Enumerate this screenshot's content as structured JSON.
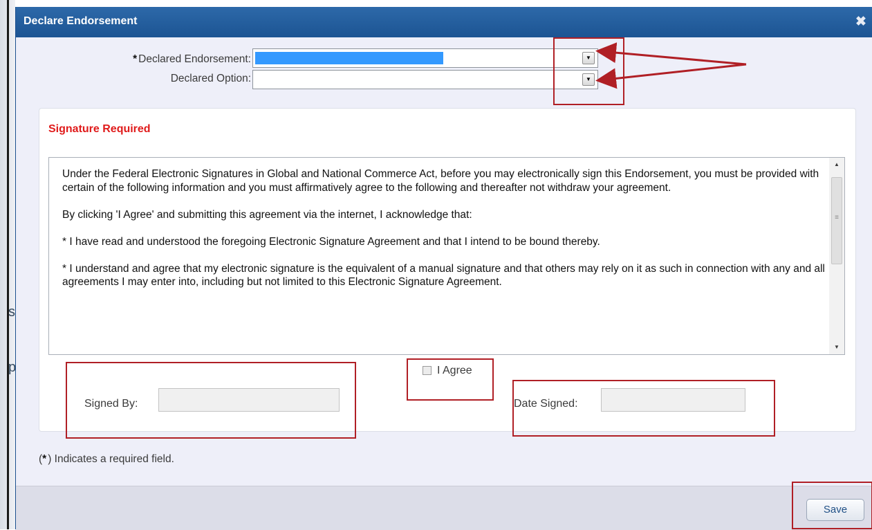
{
  "dialog": {
    "title": "Declare Endorsement",
    "close_icon": "✖"
  },
  "fields": {
    "required_marker": "*",
    "declared_endorsement_label": "Declared Endorsement:",
    "declared_endorsement_value": "",
    "declared_option_label": "Declared Option:",
    "declared_option_value": "",
    "dropdown_arrow_icon": "▼"
  },
  "signature": {
    "heading": "Signature Required",
    "agreement_paragraphs": [
      "Under the Federal Electronic Signatures in Global and National Commerce Act, before you may electronically sign this Endorsement, you must be provided with certain of the following information and you must affirmatively agree to the following and thereafter not withdraw your agreement.",
      "By clicking 'I Agree' and submitting this agreement via the internet, I acknowledge that:",
      "* I have read and understood the foregoing Electronic Signature Agreement and that I intend to be bound thereby.",
      "* I understand and agree that my electronic signature is the equivalent of a manual signature and that others may rely on it as such in connection with any and all agreements I may enter into, including but not limited to this Electronic Signature Agreement."
    ],
    "scroll_up_icon": "▲",
    "scroll_down_icon": "▼",
    "scroll_grip": "≡",
    "agree_label": "I Agree",
    "agree_checked": false,
    "signed_by_label": "Signed By:",
    "signed_by_value": "",
    "date_signed_label": "Date Signed:",
    "date_signed_value": ""
  },
  "required_note": {
    "open": "(",
    "star": "*",
    "text": ") Indicates a required field."
  },
  "footer": {
    "save_label": "Save"
  },
  "left_fragments": {
    "a": "s",
    "b": "p"
  },
  "colors": {
    "title_bar": "#1f5896",
    "heading_red": "#e01b1b",
    "annotation_red": "#b01f25",
    "select_highlight": "#3399ff"
  }
}
